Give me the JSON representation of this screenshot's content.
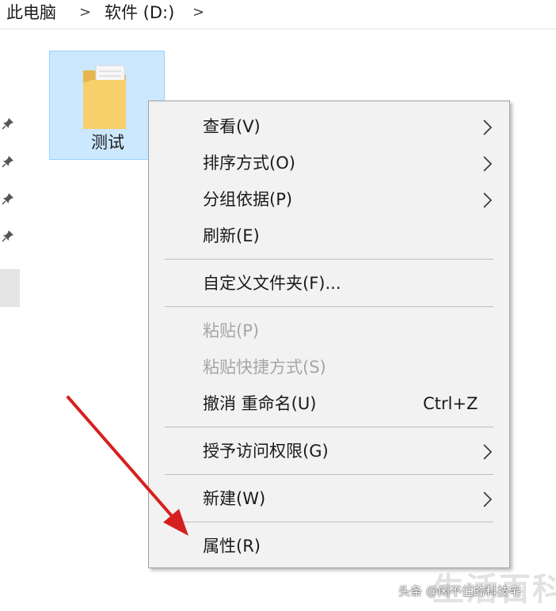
{
  "breadcrumb": {
    "items": [
      "此电脑",
      "软件 (D:)"
    ],
    "separator": ">"
  },
  "folder": {
    "name": "测试",
    "selected": true,
    "icon": "folder-icon"
  },
  "context_menu": {
    "items": [
      {
        "label": "查看(V)",
        "submenu": true,
        "enabled": true
      },
      {
        "label": "排序方式(O)",
        "submenu": true,
        "enabled": true
      },
      {
        "label": "分组依据(P)",
        "submenu": true,
        "enabled": true
      },
      {
        "label": "刷新(E)",
        "submenu": false,
        "enabled": true
      },
      {
        "label": "自定义文件夹(F)...",
        "submenu": false,
        "enabled": true
      },
      {
        "label": "粘贴(P)",
        "submenu": false,
        "enabled": false
      },
      {
        "label": "粘贴快捷方式(S)",
        "submenu": false,
        "enabled": false
      },
      {
        "label": "撤消 重命名(U)",
        "shortcut": "Ctrl+Z",
        "submenu": false,
        "enabled": true
      },
      {
        "label": "授予访问权限(G)",
        "submenu": true,
        "enabled": true
      },
      {
        "label": "新建(W)",
        "submenu": true,
        "enabled": true
      },
      {
        "label": "属性(R)",
        "submenu": false,
        "enabled": true
      }
    ]
  },
  "annotation": {
    "arrow_color": "#d62020",
    "points_to": "属性(R)"
  },
  "watermark": {
    "source": "头条 @闲不住的科技宅",
    "logo_text": "生活百科"
  },
  "colors": {
    "selection_fill": "#cce8ff",
    "selection_border": "#99d1ff",
    "menu_background": "#f2f2f2",
    "disabled_text": "#a6a6a6"
  }
}
